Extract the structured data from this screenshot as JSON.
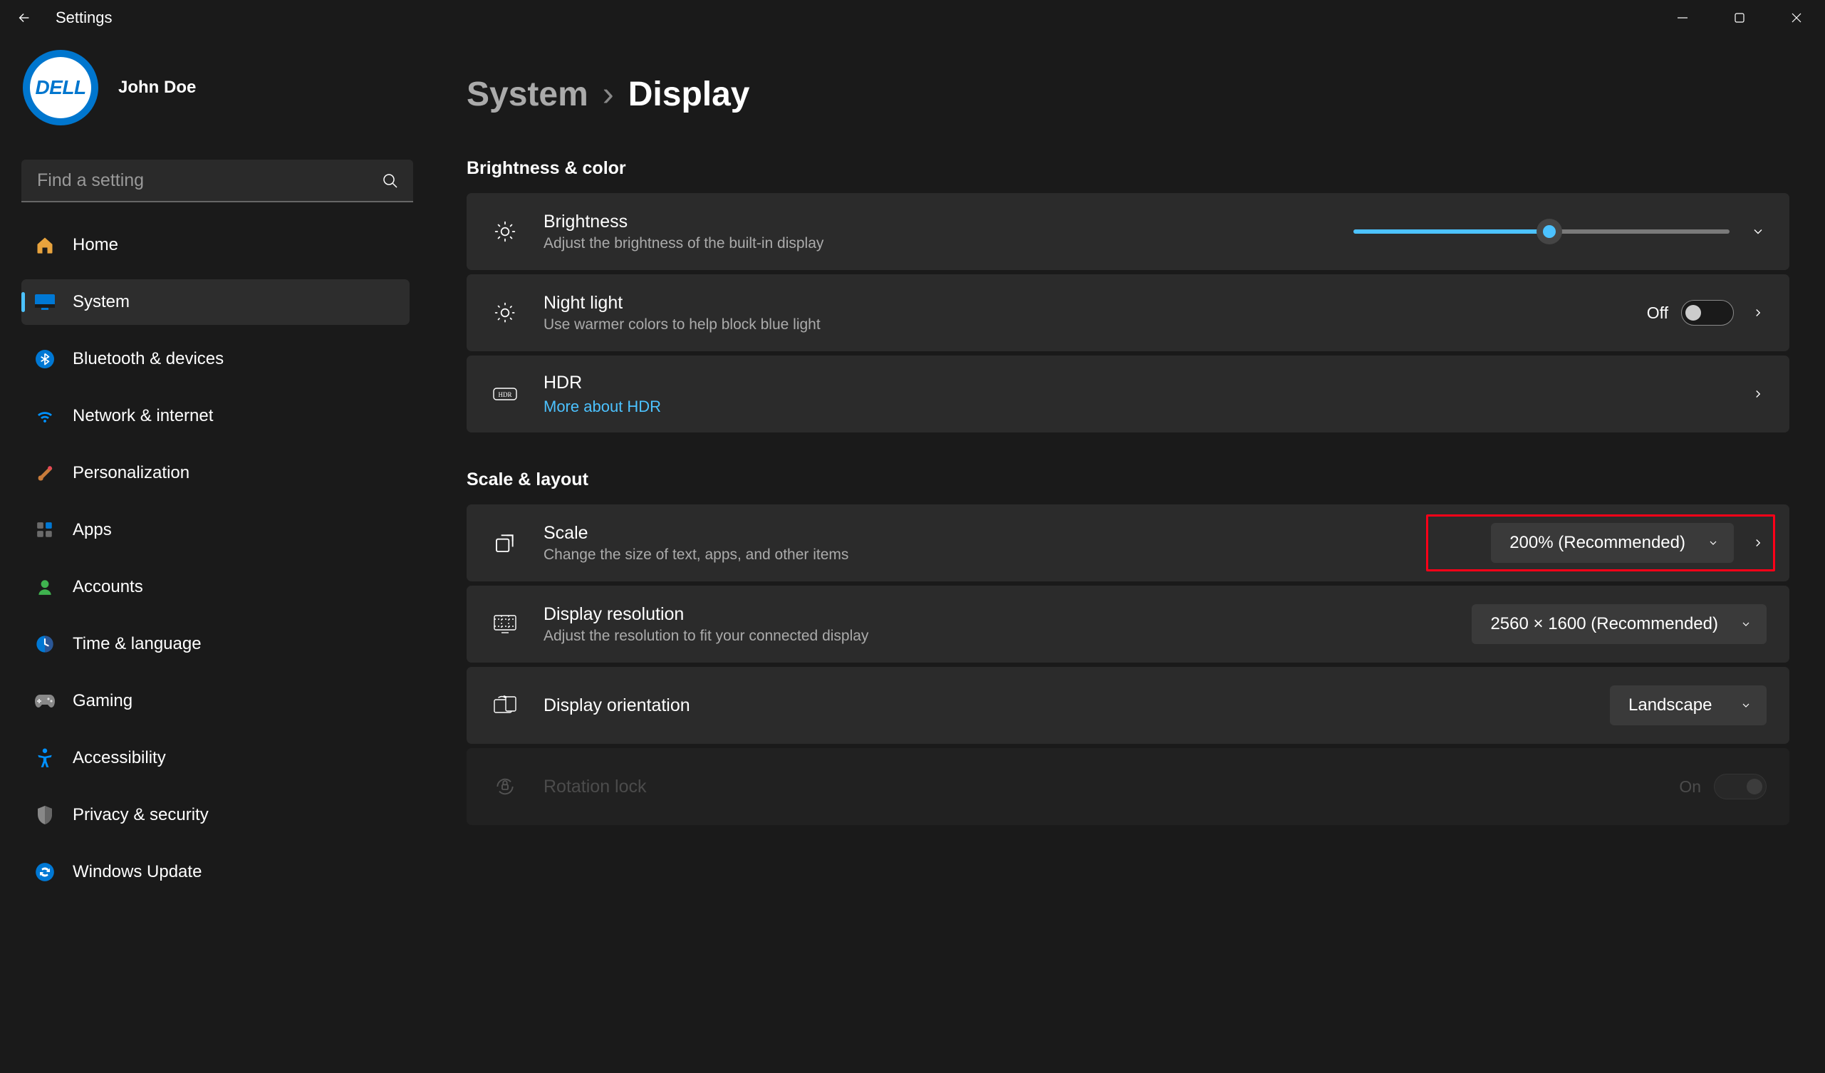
{
  "window": {
    "title": "Settings"
  },
  "user": {
    "name": "John Doe",
    "avatar_text": "DELL"
  },
  "search": {
    "placeholder": "Find a setting"
  },
  "nav": [
    {
      "label": "Home"
    },
    {
      "label": "System"
    },
    {
      "label": "Bluetooth & devices"
    },
    {
      "label": "Network & internet"
    },
    {
      "label": "Personalization"
    },
    {
      "label": "Apps"
    },
    {
      "label": "Accounts"
    },
    {
      "label": "Time & language"
    },
    {
      "label": "Gaming"
    },
    {
      "label": "Accessibility"
    },
    {
      "label": "Privacy & security"
    },
    {
      "label": "Windows Update"
    }
  ],
  "breadcrumb": {
    "parent": "System",
    "current": "Display"
  },
  "sections": {
    "brightness_color": "Brightness & color",
    "scale_layout": "Scale & layout"
  },
  "brightness": {
    "title": "Brightness",
    "sub": "Adjust the brightness of the built-in display",
    "value_percent": 52
  },
  "night_light": {
    "title": "Night light",
    "sub": "Use warmer colors to help block blue light",
    "state_label": "Off"
  },
  "hdr": {
    "title": "HDR",
    "link": "More about HDR"
  },
  "scale": {
    "title": "Scale",
    "sub": "Change the size of text, apps, and other items",
    "value": "200% (Recommended)"
  },
  "resolution": {
    "title": "Display resolution",
    "sub": "Adjust the resolution to fit your connected display",
    "value": "2560 × 1600 (Recommended)"
  },
  "orientation": {
    "title": "Display orientation",
    "value": "Landscape"
  },
  "rotation": {
    "title": "Rotation lock",
    "state_label": "On"
  }
}
